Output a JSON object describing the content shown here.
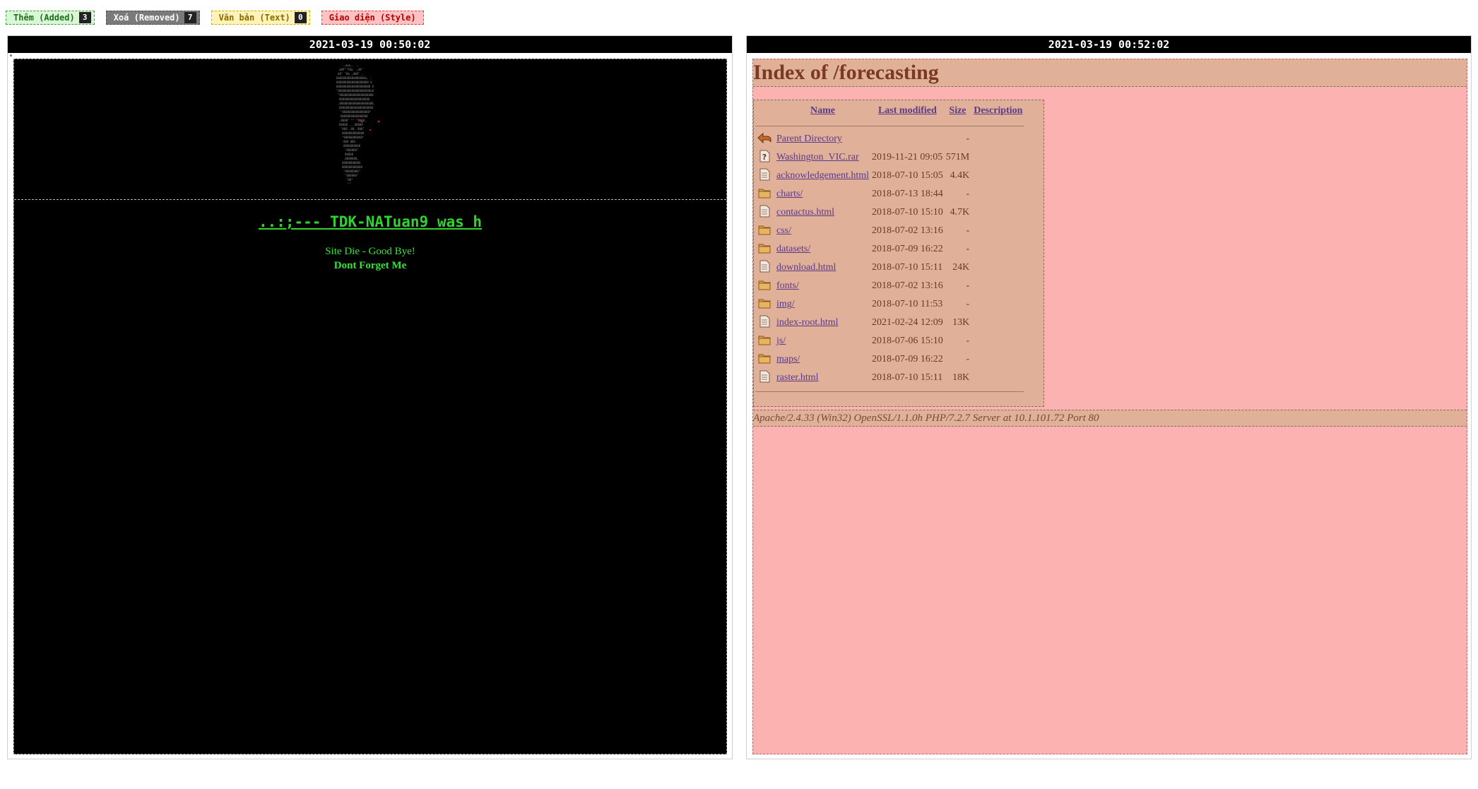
{
  "legend": {
    "added": {
      "label": "Thêm (Added)",
      "count": "3"
    },
    "removed": {
      "label": "Xoá (Removed)",
      "count": "7"
    },
    "text": {
      "label": "Văn bản (Text)",
      "count": "0"
    },
    "style": {
      "label": "Giao diện (Style)"
    }
  },
  "left_panel": {
    "timestamp": "2021-03-19 00:50:02",
    "hack_title": "..:;--- TDK-NATuan9 was h",
    "line1": "Site Die - Good Bye!",
    "line2": "Dont Forget Me"
  },
  "right_panel": {
    "timestamp": "2021-03-19 00:52:02",
    "index_title": "Index of /forecasting",
    "columns": {
      "name": "Name",
      "modified": "Last modified",
      "size": "Size",
      "description": "Description"
    },
    "rows": [
      {
        "icon": "back-arrow-icon",
        "name": "Parent Directory",
        "modified": "",
        "size": "-"
      },
      {
        "icon": "unknown-file-icon",
        "name": "Washington_VIC.rar",
        "modified": "2019-11-21 09:05",
        "size": "571M"
      },
      {
        "icon": "text-file-icon",
        "name": "acknowledgement.html",
        "modified": "2018-07-10 15:05",
        "size": "4.4K"
      },
      {
        "icon": "folder-icon",
        "name": "charts/",
        "modified": "2018-07-13 18:44",
        "size": "-"
      },
      {
        "icon": "text-file-icon",
        "name": "contactus.html",
        "modified": "2018-07-10 15:10",
        "size": "4.7K"
      },
      {
        "icon": "folder-icon",
        "name": "css/",
        "modified": "2018-07-02 13:16",
        "size": "-"
      },
      {
        "icon": "folder-icon",
        "name": "datasets/",
        "modified": "2018-07-09 16:22",
        "size": "-"
      },
      {
        "icon": "text-file-icon",
        "name": "download.html",
        "modified": "2018-07-10 15:11",
        "size": "24K"
      },
      {
        "icon": "folder-icon",
        "name": "fonts/",
        "modified": "2018-07-02 13:16",
        "size": "-"
      },
      {
        "icon": "folder-icon",
        "name": "img/",
        "modified": "2018-07-10 11:53",
        "size": "-"
      },
      {
        "icon": "text-file-icon",
        "name": "index-root.html",
        "modified": "2021-02-24 12:09",
        "size": "13K"
      },
      {
        "icon": "folder-icon",
        "name": "js/",
        "modified": "2018-07-06 15:10",
        "size": "-"
      },
      {
        "icon": "folder-icon",
        "name": "maps/",
        "modified": "2018-07-09 16:22",
        "size": "-"
      },
      {
        "icon": "text-file-icon",
        "name": "raster.html",
        "modified": "2018-07-10 15:11",
        "size": "18K"
      }
    ],
    "server_line": "Apache/2.4.33 (Win32) OpenSSL/1.1.0h PHP/7.2.7 Server at 10.1.101.72 Port 80"
  }
}
